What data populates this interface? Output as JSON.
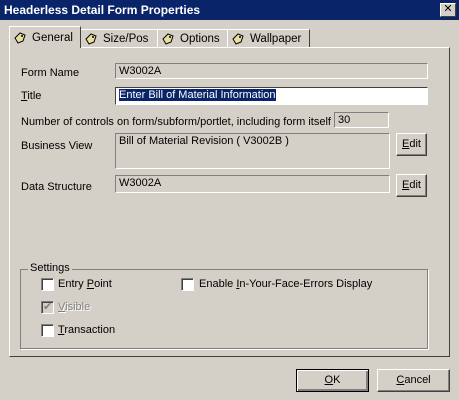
{
  "window": {
    "title": "Headerless Detail Form Properties",
    "close_glyph": "✕"
  },
  "tabs": [
    {
      "label": "General",
      "icon": "tag-icon",
      "active": true
    },
    {
      "label": "Size/Pos",
      "icon": "tag-icon",
      "active": false
    },
    {
      "label": "Options",
      "icon": "tag-icon",
      "active": false
    },
    {
      "label": "Wallpaper",
      "icon": "tag-icon",
      "active": false
    }
  ],
  "form": {
    "form_name_label": "Form Name",
    "form_name_value": "W3002A",
    "title_label_hotkey": "T",
    "title_label_rest": "itle",
    "title_value": "Enter Bill of Material Information",
    "controls_label": "Number of controls on form/subform/portlet, including form itself",
    "controls_value": "30",
    "business_view_label": "Business View",
    "business_view_value": "Bill of Material Revision ( V3002B )",
    "data_structure_label": "Data Structure",
    "data_structure_value": "W3002A",
    "edit_hotkey": "E",
    "edit_rest": "dit"
  },
  "settings": {
    "legend": "Settings",
    "entry_point": {
      "pre": "Entry ",
      "hotkey": "P",
      "post": "oint",
      "checked": false
    },
    "visible": {
      "pre": "",
      "hotkey": "V",
      "post": "isible",
      "checked": true,
      "disabled": true
    },
    "transaction": {
      "pre": "",
      "hotkey": "T",
      "post": "ransaction",
      "checked": false
    },
    "errors_display": {
      "pre": "Enable ",
      "hotkey": "I",
      "post": "n-Your-Face-Errors Display",
      "checked": false
    }
  },
  "buttons": {
    "ok": {
      "hotkey": "O",
      "rest": "K"
    },
    "cancel": {
      "hotkey": "C",
      "rest": "ancel"
    }
  },
  "colors": {
    "titlebar": "#0a246a",
    "dialog_bg": "#d4d0c8",
    "selection": "#0a246a"
  }
}
